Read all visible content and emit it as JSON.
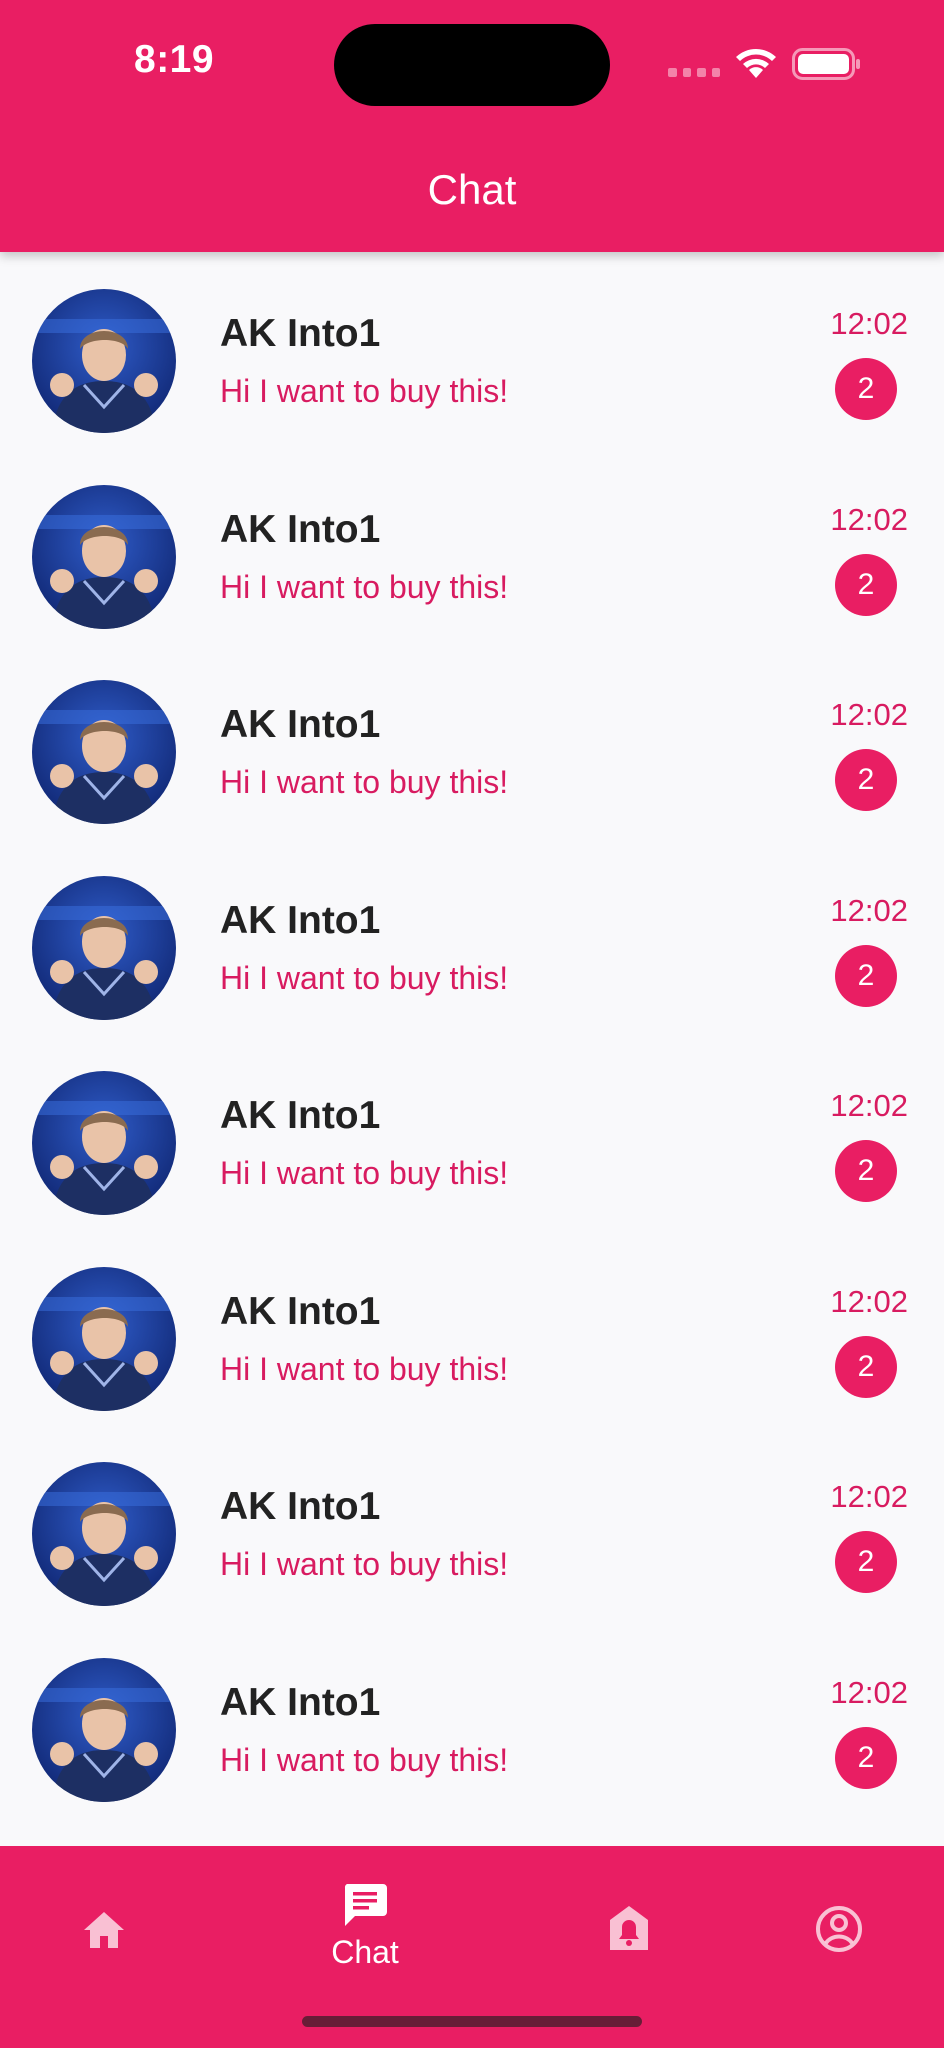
{
  "status_bar": {
    "time": "8:19"
  },
  "header": {
    "title": "Chat"
  },
  "colors": {
    "primary": "#e91e63",
    "accent_text": "#d81b60",
    "background": "#f9f9fb"
  },
  "chats": [
    {
      "name": "AK Into1",
      "message": "Hi I want to buy this!",
      "time": "12:02",
      "unread": "2"
    },
    {
      "name": "AK Into1",
      "message": "Hi I want to buy this!",
      "time": "12:02",
      "unread": "2"
    },
    {
      "name": "AK Into1",
      "message": "Hi I want to buy this!",
      "time": "12:02",
      "unread": "2"
    },
    {
      "name": "AK Into1",
      "message": "Hi I want to buy this!",
      "time": "12:02",
      "unread": "2"
    },
    {
      "name": "AK Into1",
      "message": "Hi I want to buy this!",
      "time": "12:02",
      "unread": "2"
    },
    {
      "name": "AK Into1",
      "message": "Hi I want to buy this!",
      "time": "12:02",
      "unread": "2"
    },
    {
      "name": "AK Into1",
      "message": "Hi I want to buy this!",
      "time": "12:02",
      "unread": "2"
    },
    {
      "name": "AK Into1",
      "message": "Hi I want to buy this!",
      "time": "12:02",
      "unread": "2"
    }
  ],
  "bottom_nav": {
    "items": [
      {
        "icon": "home-icon"
      },
      {
        "icon": "chat-icon",
        "label": "Chat",
        "active": true
      },
      {
        "icon": "notification-bell-icon"
      },
      {
        "icon": "profile-icon"
      }
    ]
  }
}
